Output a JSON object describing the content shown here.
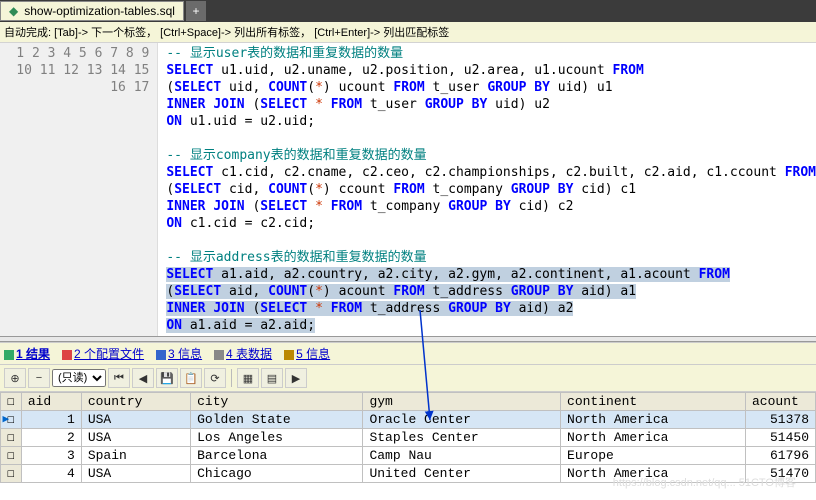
{
  "tab": {
    "filename": "show-optimization-tables.sql",
    "plus": "+"
  },
  "hint": "自动完成: [Tab]-> 下一个标签， [Ctrl+Space]-> 列出所有标签， [Ctrl+Enter]-> 列出匹配标签",
  "code": {
    "l1": {
      "a": "-- 显示user表的数据和重复数据的数量"
    },
    "l2": {
      "a": "SELECT",
      "b": " u1.uid, u2.uname, u2.position, u2.area, u1.ucount ",
      "c": "FROM"
    },
    "l3": {
      "a": "(",
      "b": "SELECT",
      "c": " uid, ",
      "d": "COUNT",
      "e": "(",
      "f": "*",
      "g": ") ucount ",
      "h": "FROM",
      "i": " t_user ",
      "j": "GROUP BY",
      "k": " uid) u1"
    },
    "l4": {
      "a": "INNER JOIN",
      "b": " (",
      "c": "SELECT",
      "d": " ",
      "e": "*",
      "f": " ",
      "g": "FROM",
      "h": " t_user ",
      "i": "GROUP BY",
      "j": " uid) u2"
    },
    "l5": {
      "a": "ON",
      "b": " u1.uid = u2.uid;"
    },
    "l7": {
      "a": "-- 显示company表的数据和重复数据的数量"
    },
    "l8": {
      "a": "SELECT",
      "b": " c1.cid, c2.cname, c2.ceo, c2.championships, c2.built, c2.aid, c1.ccount ",
      "c": "FROM"
    },
    "l9": {
      "a": "(",
      "b": "SELECT",
      "c": " cid, ",
      "d": "COUNT",
      "e": "(",
      "f": "*",
      "g": ") ccount ",
      "h": "FROM",
      "i": " t_company ",
      "j": "GROUP BY",
      "k": " cid) c1"
    },
    "l10": {
      "a": "INNER JOIN",
      "b": " (",
      "c": "SELECT",
      "d": " ",
      "e": "*",
      "f": " ",
      "g": "FROM",
      "h": " t_company ",
      "i": "GROUP BY",
      "j": " cid) c2"
    },
    "l11": {
      "a": "ON",
      "b": " c1.cid = c2.cid;"
    },
    "l13": {
      "a": "-- 显示address表的数据和重复数据的数量"
    },
    "l14": {
      "a": "SELECT",
      "b": " a1.aid, a2.country, a2.city, a2.gym, a2.continent, a1.acount ",
      "c": "FROM"
    },
    "l15": {
      "a": "(",
      "b": "SELECT",
      "c": " aid, ",
      "d": "COUNT",
      "e": "(",
      "f": "*",
      "g": ") acount ",
      "h": "FROM",
      "i": " t_address ",
      "j": "GROUP BY",
      "k": " aid) a1"
    },
    "l16": {
      "a": "INNER JOIN",
      "b": " (",
      "c": "SELECT",
      "d": " ",
      "e": "*",
      "f": " ",
      "g": "FROM",
      "h": " t_address ",
      "i": "GROUP BY",
      "j": " aid) a2"
    },
    "l17": {
      "a": "ON",
      "b": " a1.aid = a2.aid;"
    }
  },
  "resultsTabs": {
    "t1": "1 结果",
    "t2": "2 个配置文件",
    "t3": "3 信息",
    "t4": "4 表数据",
    "t5": "5 信息"
  },
  "toolbar": {
    "readonly": "(只读)",
    "nav1": "◀",
    "nav2": "▶"
  },
  "grid": {
    "headers": {
      "aid": "aid",
      "country": "country",
      "city": "city",
      "gym": "gym",
      "continent": "continent",
      "acount": "acount"
    },
    "rows": [
      {
        "aid": "1",
        "country": "USA",
        "city": "Golden State",
        "gym": "Oracle Center",
        "continent": "North America",
        "acount": "51378"
      },
      {
        "aid": "2",
        "country": "USA",
        "city": "Los Angeles",
        "gym": "Staples Center",
        "continent": "North America",
        "acount": "51450"
      },
      {
        "aid": "3",
        "country": "Spain",
        "city": "Barcelona",
        "gym": "Camp Nau",
        "continent": "Europe",
        "acount": "61796"
      },
      {
        "aid": "4",
        "country": "USA",
        "city": "Chicago",
        "gym": "United Center",
        "continent": "North America",
        "acount": "51470"
      }
    ]
  },
  "watermark": "https://blog.csdn.net/qq... 51CTO博客"
}
